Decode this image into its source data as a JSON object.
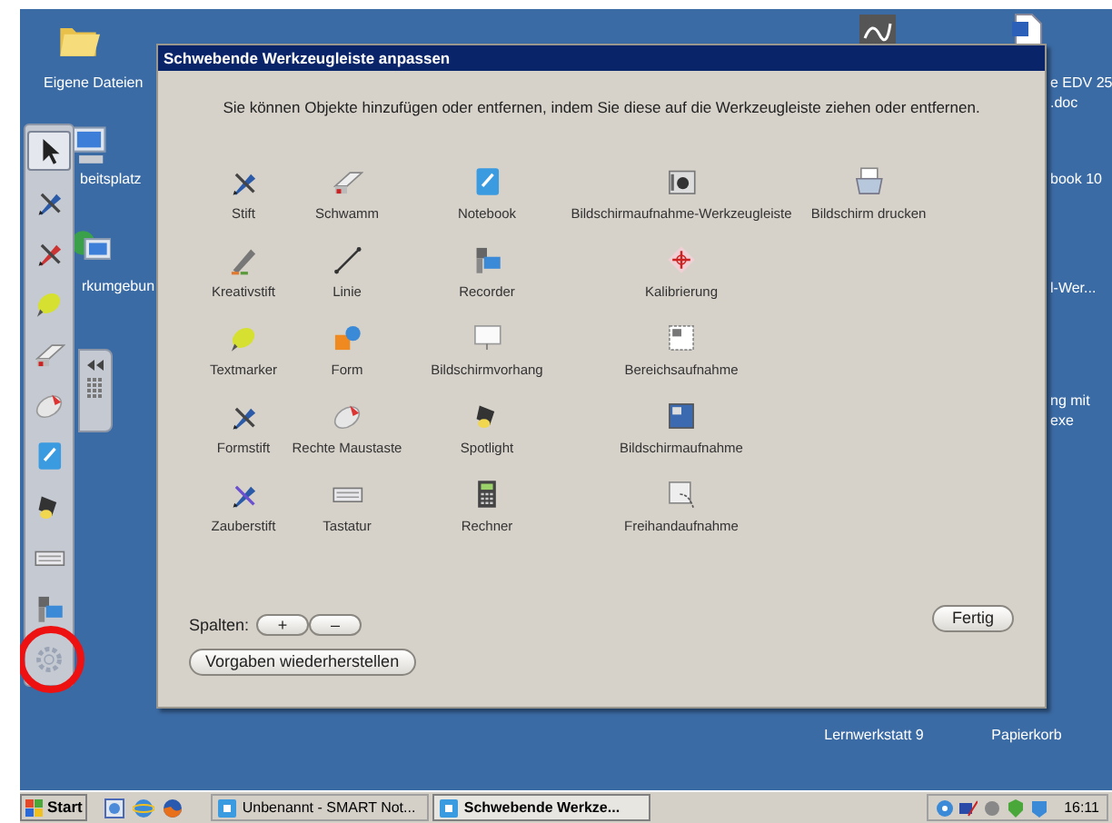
{
  "desktop": {
    "left_icons": [
      {
        "label": "Eigene Dateien",
        "kind": "folder"
      },
      {
        "label": "beitsplatz",
        "kind": "computer"
      },
      {
        "label": "rkumgebun",
        "kind": "network"
      }
    ],
    "right_labels": [
      {
        "lines": [
          "e EDV 25",
          ".doc"
        ]
      },
      {
        "lines": [
          "book 10"
        ]
      },
      {
        "lines": [
          "l-Wer..."
        ]
      },
      {
        "lines": [
          "ng mit",
          "exe"
        ]
      }
    ],
    "bottom_icons": [
      {
        "label": "Lernwerkstatt 9"
      },
      {
        "label": "Papierkorb"
      }
    ]
  },
  "floating_toolbar": {
    "items": [
      {
        "kind": "arrow",
        "selected": true,
        "marked": false
      },
      {
        "kind": "pen",
        "selected": false,
        "marked": false
      },
      {
        "kind": "pen-red",
        "selected": false,
        "marked": false
      },
      {
        "kind": "highlighter",
        "selected": false,
        "marked": false
      },
      {
        "kind": "eraser",
        "selected": false,
        "marked": false
      },
      {
        "kind": "mouse",
        "selected": false,
        "marked": false
      },
      {
        "kind": "notebook",
        "selected": false,
        "marked": false
      },
      {
        "kind": "spotlight",
        "selected": false,
        "marked": false
      },
      {
        "kind": "keyboard",
        "selected": false,
        "marked": false
      },
      {
        "kind": "recorder",
        "selected": false,
        "marked": false
      },
      {
        "kind": "gear",
        "selected": false,
        "marked": true
      }
    ]
  },
  "dialog": {
    "title": "Schwebende Werkzeugleiste anpassen",
    "instruction": "Sie können Objekte hinzufügen oder entfernen, indem Sie diese auf die Werkzeugleiste ziehen oder entfernen.",
    "tool_rows": [
      [
        {
          "label": "Stift",
          "kind": "pen"
        },
        {
          "label": "Schwamm",
          "kind": "eraser"
        },
        {
          "label": "Notebook",
          "kind": "notebook"
        },
        {
          "label": "Bildschirmaufnahme-Werkzeugleiste",
          "kind": "camera"
        },
        {
          "label": "Bildschirm drucken",
          "kind": "printer"
        }
      ],
      [
        {
          "label": "Kreativstift",
          "kind": "creative-pen"
        },
        {
          "label": "Linie",
          "kind": "line"
        },
        {
          "label": "Recorder",
          "kind": "recorder"
        },
        {
          "label": "Kalibrierung",
          "kind": "target"
        }
      ],
      [
        {
          "label": "Textmarker",
          "kind": "highlighter"
        },
        {
          "label": "Form",
          "kind": "shapes"
        },
        {
          "label": "Bildschirmvorhang",
          "kind": "screen"
        },
        {
          "label": "Bereichsaufnahme",
          "kind": "area-capture"
        }
      ],
      [
        {
          "label": "Formstift",
          "kind": "shape-pen"
        },
        {
          "label": "Rechte Maustaste",
          "kind": "mouse"
        },
        {
          "label": "Spotlight",
          "kind": "spotlight"
        },
        {
          "label": "Bildschirmaufnahme",
          "kind": "screen-capture"
        }
      ],
      [
        {
          "label": "Zauberstift",
          "kind": "magic-pen"
        },
        {
          "label": "Tastatur",
          "kind": "keyboard"
        },
        {
          "label": "Rechner",
          "kind": "calculator"
        },
        {
          "label": "Freihandaufnahme",
          "kind": "freehand-capture"
        }
      ]
    ],
    "columns_label": "Spalten:",
    "column_buttons": [
      "+",
      "–"
    ],
    "reset_button": "Vorgaben wiederherstellen",
    "done_button": "Fertig"
  },
  "taskbar": {
    "start": "Start",
    "tasks": [
      {
        "label": "Unbenannt - SMART Not...",
        "selected": false
      },
      {
        "label": "Schwebende Werkze...",
        "selected": true
      }
    ],
    "clock": "16:11"
  }
}
